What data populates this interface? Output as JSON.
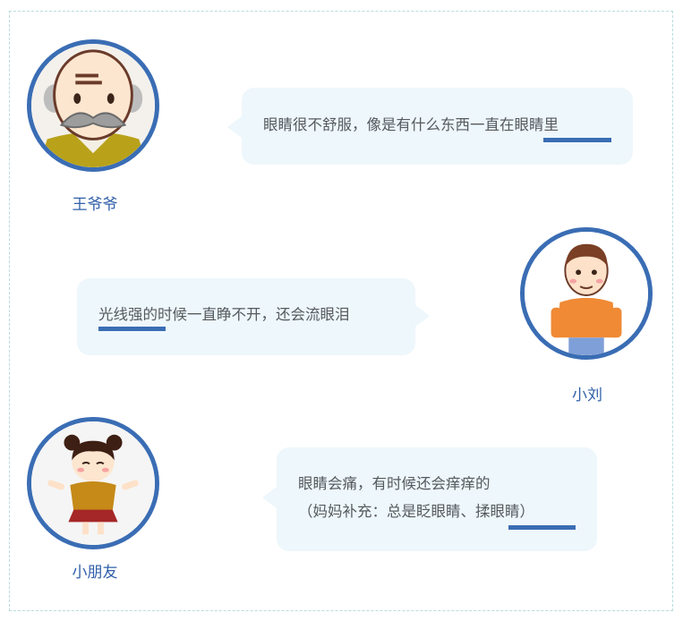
{
  "conversation": [
    {
      "speaker": "王爷爷",
      "avatar_icon": "grandpa-avatar-icon",
      "lines": [
        "眼睛很不舒服，像是有什么东西一直在眼睛里"
      ],
      "highlight": "眼睛里"
    },
    {
      "speaker": "小刘",
      "avatar_icon": "young-man-avatar-icon",
      "lines": [
        "光线强的时候一直睁不开，还会流眼泪"
      ],
      "highlight": "光线强"
    },
    {
      "speaker": "小朋友",
      "avatar_icon": "child-avatar-icon",
      "lines": [
        "眼睛会痛，有时候还会痒痒的",
        "（妈妈补充：总是眨眼睛、揉眼睛）"
      ],
      "highlight": "揉眼睛）"
    }
  ],
  "colors": {
    "accent": "#3a6db4",
    "bubble_bg": "#eef7fb",
    "text": "#555a5f",
    "frame_border": "#b9dcdc"
  }
}
